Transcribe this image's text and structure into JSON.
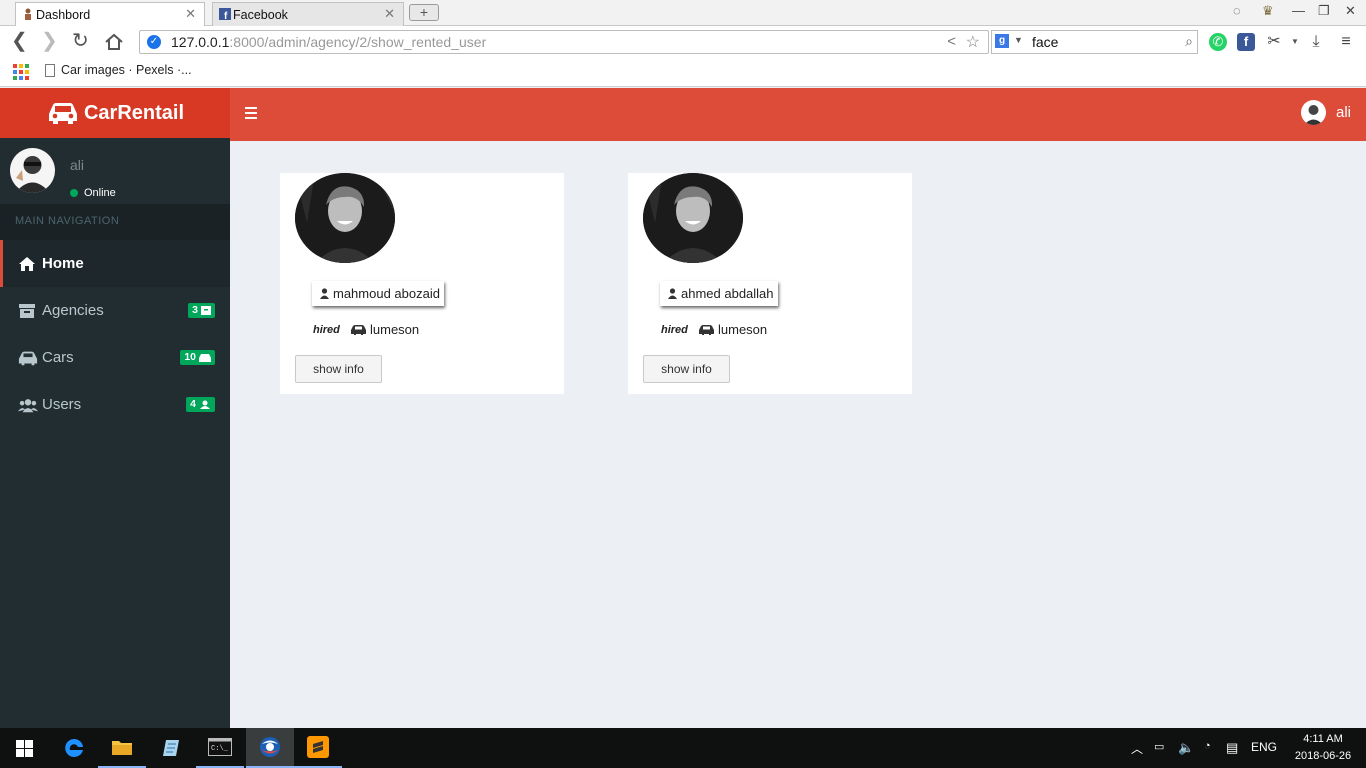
{
  "browser": {
    "tabs": [
      {
        "title": "Dashbord",
        "active": true
      },
      {
        "title": "Facebook",
        "active": false
      }
    ],
    "url_host": "127.0.0.1",
    "url_path": ":8000/admin/agency/2/show_rented_user",
    "search_query": "face",
    "bookmark": "Car images · Pexels ·..."
  },
  "app": {
    "brand": "CarRentail",
    "top_user": "ali",
    "accent": "#dd4b39"
  },
  "sidebar": {
    "user_name": "ali",
    "status": "Online",
    "nav_header": "MAIN NAVIGATION",
    "items": [
      {
        "label": "Home",
        "icon": "home-icon",
        "badge": ""
      },
      {
        "label": "Agencies",
        "icon": "archive-icon",
        "badge": "3"
      },
      {
        "label": "Cars",
        "icon": "car-icon",
        "badge": "10"
      },
      {
        "label": "Users",
        "icon": "users-icon",
        "badge": "4"
      }
    ]
  },
  "rented_users": [
    {
      "name": "mahmoud abozaid",
      "status": "hired",
      "car": "lumeson",
      "button": "show info"
    },
    {
      "name": "ahmed abdallah",
      "status": "hired",
      "car": "lumeson",
      "button": "show info"
    }
  ],
  "taskbar": {
    "language": "ENG",
    "time": "4:11 AM",
    "date": "2018-06-26"
  }
}
